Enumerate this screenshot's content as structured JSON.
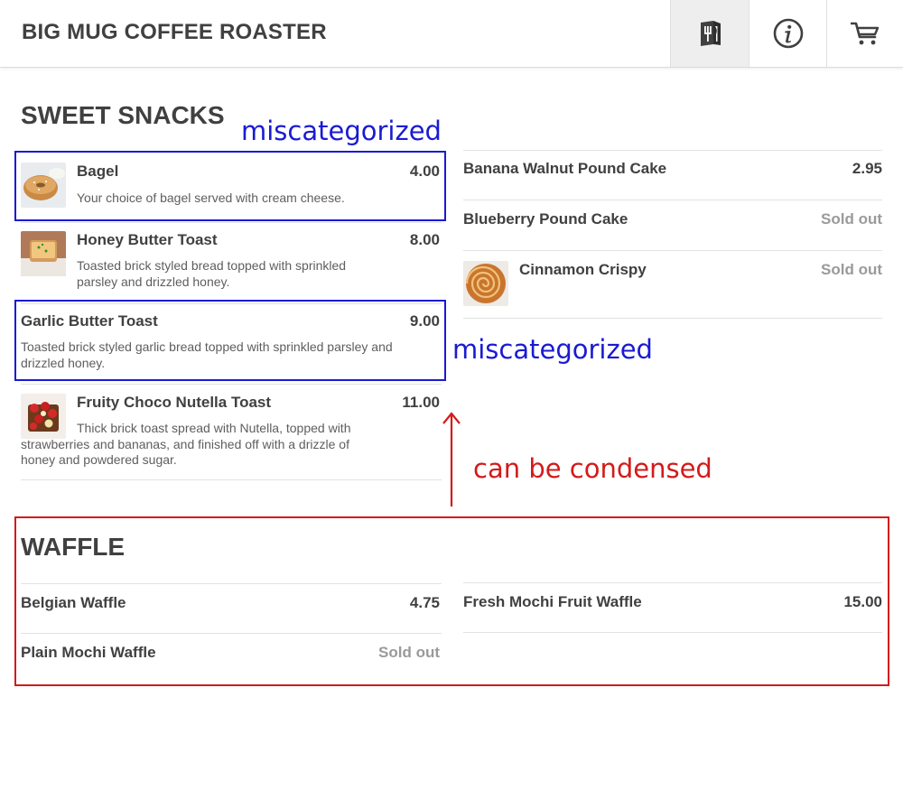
{
  "header": {
    "brand": "BIG MUG COFFEE ROASTER",
    "buttons": [
      {
        "icon": "menu-book-icon",
        "active": true
      },
      {
        "icon": "info-icon",
        "active": false
      },
      {
        "icon": "cart-icon",
        "active": false
      }
    ]
  },
  "sections": {
    "sweet_snacks": {
      "title": "SWEET SNACKS",
      "left": [
        {
          "name": "Bagel",
          "price": "4.00",
          "desc": "Your choice of bagel served with cream cheese.",
          "image": "bagel"
        },
        {
          "name": "Honey Butter Toast",
          "price": "8.00",
          "desc": "Toasted brick styled bread topped with sprinkled parsley and drizzled honey.",
          "image": "toast"
        },
        {
          "name": "Garlic Butter Toast",
          "price": "9.00",
          "desc": "Toasted brick styled garlic bread topped with sprinkled parsley and drizzled honey."
        },
        {
          "name": "Fruity Choco Nutella Toast",
          "price": "11.00",
          "desc": "Thick brick toast spread with Nutella, topped with strawberries and bananas, and finished off with a drizzle of honey and powdered sugar.",
          "image": "nutella-toast"
        }
      ],
      "right": [
        {
          "name": "Banana Walnut Pound Cake",
          "price": "2.95"
        },
        {
          "name": "Blueberry Pound Cake",
          "price": "Sold out"
        },
        {
          "name": "Cinnamon Crispy",
          "price": "Sold out",
          "image": "cinnamon-roll"
        }
      ]
    },
    "waffle": {
      "title": "WAFFLE",
      "left": [
        {
          "name": "Belgian Waffle",
          "price": "4.75"
        },
        {
          "name": "Plain Mochi Waffle",
          "price": "Sold out"
        }
      ],
      "right": [
        {
          "name": "Fresh Mochi Fruit Waffle",
          "price": "15.00"
        }
      ]
    }
  },
  "annotations": {
    "miscategorized_1": "miscategorized",
    "miscategorized_2": "miscategorized",
    "condensed": "can be condensed",
    "colors": {
      "blue": "#1a1ad4",
      "red": "#d41a1a"
    }
  }
}
